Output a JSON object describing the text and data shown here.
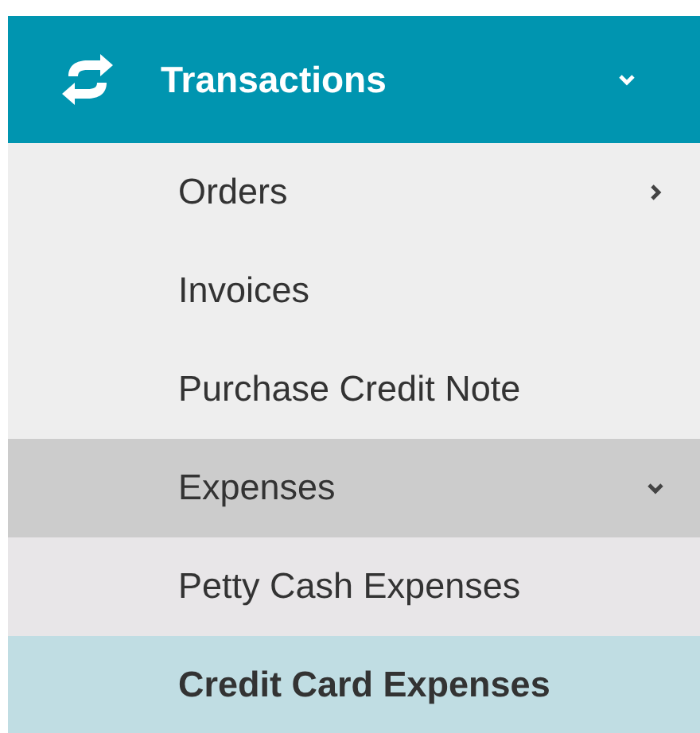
{
  "menu": {
    "title": "Transactions",
    "expanded": true,
    "items": [
      {
        "label": "Orders",
        "expanded": false,
        "selected": false
      },
      {
        "label": "Invoices",
        "selected": false
      },
      {
        "label": "Purchase Credit Note",
        "selected": false
      },
      {
        "label": "Expenses",
        "expanded": true,
        "selected": false,
        "children": [
          {
            "label": "Petty Cash Expenses",
            "selected": false
          },
          {
            "label": "Credit Card Expenses",
            "selected": true
          }
        ]
      }
    ]
  }
}
